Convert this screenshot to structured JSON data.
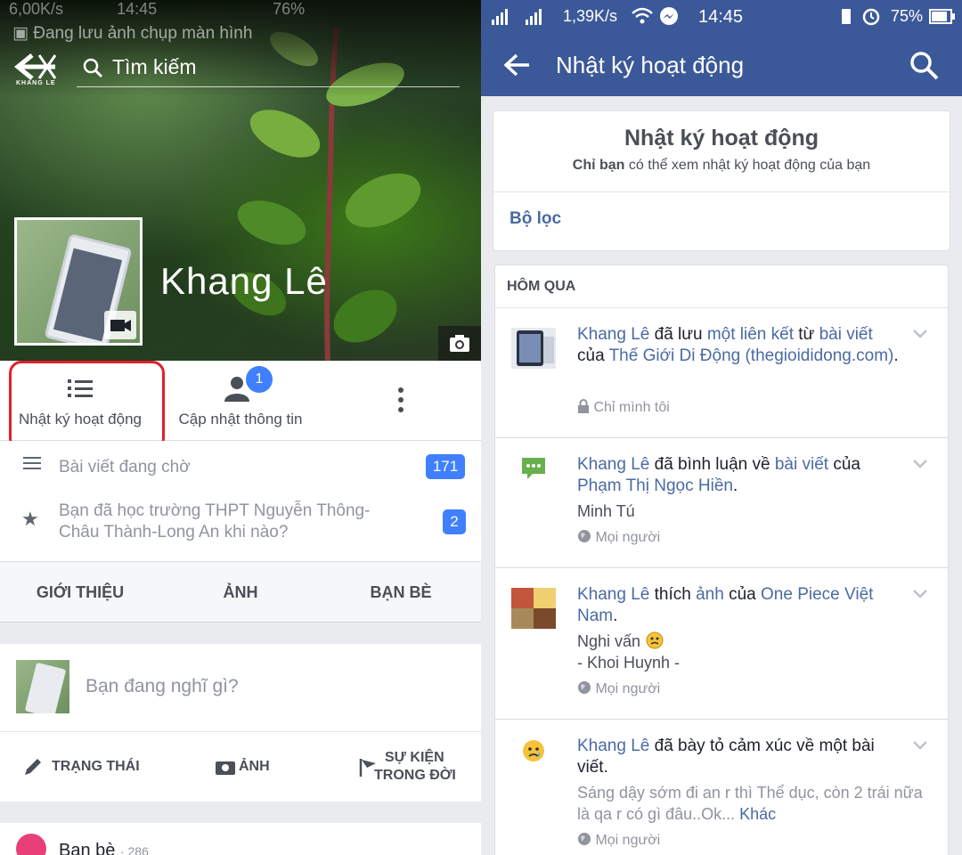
{
  "left": {
    "status": {
      "speed": "6,00K/s",
      "time": "14:45",
      "battery": "76%"
    },
    "saving_text": "Đang lưu ảnh chụp màn hình",
    "logo_text": "KHANG LE",
    "search_placeholder": "Tìm kiếm",
    "profile_name": "Khang Lê",
    "actions": {
      "activity_log": "Nhật ký hoạt động",
      "update_info": "Cập nhật thông tin",
      "update_badge": "1"
    },
    "pending_posts": {
      "label": "Bài viết đang chờ",
      "count": "171"
    },
    "school_question": {
      "line1": "Bạn đã học trường THPT Nguyễn Thông-",
      "line2": "Châu Thành-Long An khi nào?",
      "count": "2"
    },
    "tabs": [
      "GIỚI THIỆU",
      "ẢNH",
      "BẠN BÈ"
    ],
    "composer": {
      "placeholder": "Bạn đang nghĩ gì?",
      "status_btn": "TRẠNG THÁI",
      "photo_btn": "ẢNH",
      "life_event_line1": "SỰ KIỆN",
      "life_event_line2": "TRONG ĐỜI"
    },
    "friends": {
      "label": "Bạn bè",
      "count": "· 286"
    }
  },
  "right": {
    "status": {
      "speed": "1,39K/s",
      "time": "14:45",
      "battery": "75%"
    },
    "title": "Nhật ký hoạt động",
    "header_card": {
      "title": "Nhật ký hoạt động",
      "subtitle_bold": "Chỉ bạn",
      "subtitle_rest": " có thể xem nhật ký hoạt động của bạn",
      "filter": "Bộ lọc"
    },
    "section": "HÔM QUA",
    "items": [
      {
        "actor": "Khang Lê",
        "t1": " đã lưu ",
        "l1": "một liên kết",
        "t2": " từ ",
        "l2": "bài viết",
        "t3": " của ",
        "l3": "Thế Giới Di Động (thegioididong.com)",
        "t4": ".",
        "privacy": "Chỉ mình tôi"
      },
      {
        "actor": "Khang Lê",
        "t1": " đã bình luận về ",
        "l1": "bài viết",
        "t2": " của ",
        "l2": "Phạm Thị Ngọc Hiền",
        "t3": ".",
        "tag": "Minh Tú",
        "privacy": "Mọi người"
      },
      {
        "actor": "Khang Lê",
        "t1": " thích ",
        "l1": "ảnh",
        "t2": " của ",
        "l2": "One Piece Việt Nam",
        "t3": ".",
        "line1": "Nghi vấn",
        "line2": "- Khoi Huynh -",
        "privacy": "Mọi người"
      },
      {
        "actor": "Khang Lê",
        "t1": " đã bày tỏ cảm xúc về một bài viết.",
        "excerpt": "Sáng dậy sớm đi an r thì Thể dục, còn 2 trái nữa là qa r có gì đâu..Ok... ",
        "more": "Khác",
        "privacy": "Mọi người"
      }
    ]
  }
}
